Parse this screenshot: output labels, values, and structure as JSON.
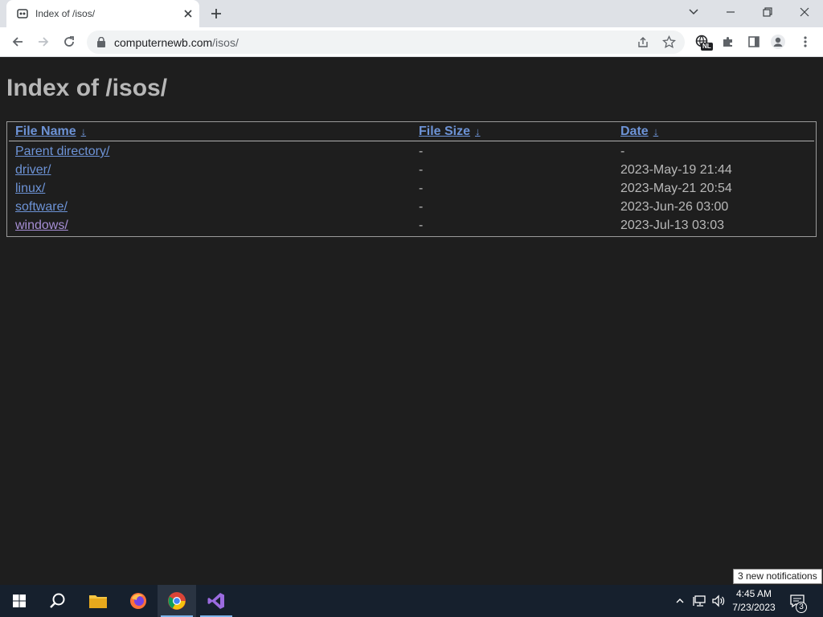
{
  "browser": {
    "tab_title": "Index of /isos/",
    "url_host": "computernewb.com",
    "url_path": "/isos/"
  },
  "page": {
    "title": "Index of /isos/",
    "columns": [
      {
        "label": "File Name",
        "sort_arrow": "↓"
      },
      {
        "label": "File Size",
        "sort_arrow": "↓"
      },
      {
        "label": "Date",
        "sort_arrow": "↓"
      }
    ],
    "rows": [
      {
        "name": "Parent directory/",
        "size": "-",
        "date": "-"
      },
      {
        "name": "driver/",
        "size": "-",
        "date": "2023-May-19 21:44"
      },
      {
        "name": "linux/",
        "size": "-",
        "date": "2023-May-21 20:54"
      },
      {
        "name": "software/",
        "size": "-",
        "date": "2023-Jun-26 03:00"
      },
      {
        "name": "windows/",
        "size": "-",
        "date": "2023-Jul-13 03:03"
      }
    ]
  },
  "toolbar": {
    "extension_badge": "NL"
  },
  "taskbar": {
    "time": "4:45 AM",
    "date": "7/23/2023",
    "notification_count": "3",
    "toast": "3 new notifications"
  },
  "colors": {
    "page_bg": "#1e1e1e",
    "link": "#6d93d6",
    "visited_link": "#a78fd6",
    "taskbar_bg": "#16202d"
  }
}
